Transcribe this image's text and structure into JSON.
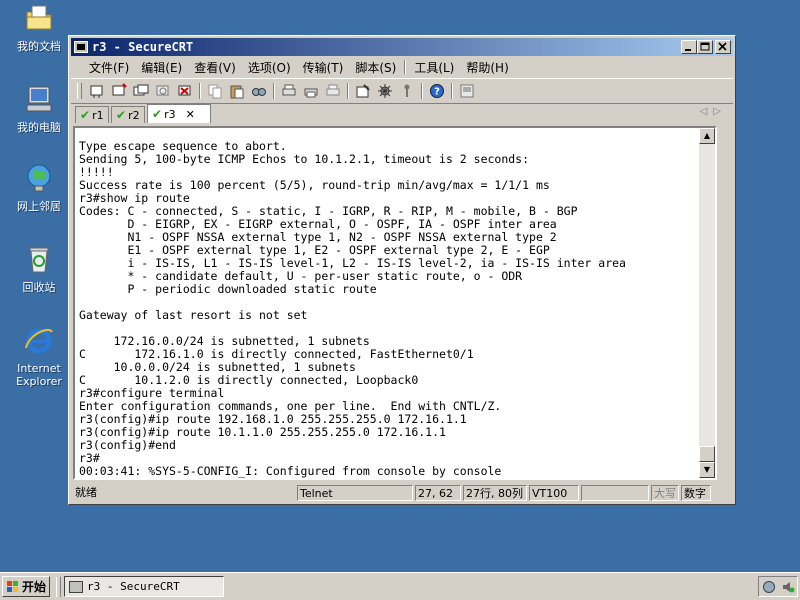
{
  "desktop": {
    "icons": [
      {
        "label": "我的文档"
      },
      {
        "label": "我的电脑"
      },
      {
        "label": "网上邻居"
      },
      {
        "label": "回收站"
      },
      {
        "label": "Internet Explorer"
      }
    ]
  },
  "window": {
    "title": "r3 - SecureCRT",
    "menu": [
      "文件(F)",
      "编辑(E)",
      "查看(V)",
      "选项(O)",
      "传输(T)",
      "脚本(S)",
      "工具(L)",
      "帮助(H)"
    ],
    "tabs": [
      {
        "label": "r1",
        "active": false
      },
      {
        "label": "r2",
        "active": false
      },
      {
        "label": "r3",
        "active": true
      }
    ]
  },
  "terminal": {
    "lines": [
      "Type escape sequence to abort.",
      "Sending 5, 100-byte ICMP Echos to 10.1.2.1, timeout is 2 seconds:",
      "!!!!!",
      "Success rate is 100 percent (5/5), round-trip min/avg/max = 1/1/1 ms",
      "r3#show ip route",
      "Codes: C - connected, S - static, I - IGRP, R - RIP, M - mobile, B - BGP",
      "       D - EIGRP, EX - EIGRP external, O - OSPF, IA - OSPF inter area",
      "       N1 - OSPF NSSA external type 1, N2 - OSPF NSSA external type 2",
      "       E1 - OSPF external type 1, E2 - OSPF external type 2, E - EGP",
      "       i - IS-IS, L1 - IS-IS level-1, L2 - IS-IS level-2, ia - IS-IS inter area",
      "       * - candidate default, U - per-user static route, o - ODR",
      "       P - periodic downloaded static route",
      "",
      "Gateway of last resort is not set",
      "",
      "     172.16.0.0/24 is subnetted, 1 subnets",
      "C       172.16.1.0 is directly connected, FastEthernet0/1",
      "     10.0.0.0/24 is subnetted, 1 subnets",
      "C       10.1.2.0 is directly connected, Loopback0",
      "r3#configure terminal",
      "Enter configuration commands, one per line.  End with CNTL/Z.",
      "r3(config)#ip route 192.168.1.0 255.255.255.0 172.16.1.1",
      "r3(config)#ip route 10.1.1.0 255.255.255.0 172.16.1.1",
      "r3(config)#end",
      "r3#",
      "00:03:41: %SYS-5-CONFIG_I: Configured from console by console"
    ]
  },
  "statusbar": {
    "ready": "就绪",
    "protocol": "Telnet",
    "cursor": "27,  62",
    "rows_cols": "27行, 80列",
    "emulation": "VT100",
    "caps": "大写",
    "num": "数字"
  },
  "taskbar": {
    "start_label": "开始",
    "task_label": "r3 - SecureCRT"
  },
  "colors": {
    "desktop": "#3a6ea5",
    "title_start": "#0a246a",
    "title_end": "#a6caf0",
    "check": "#2a9a2a"
  }
}
